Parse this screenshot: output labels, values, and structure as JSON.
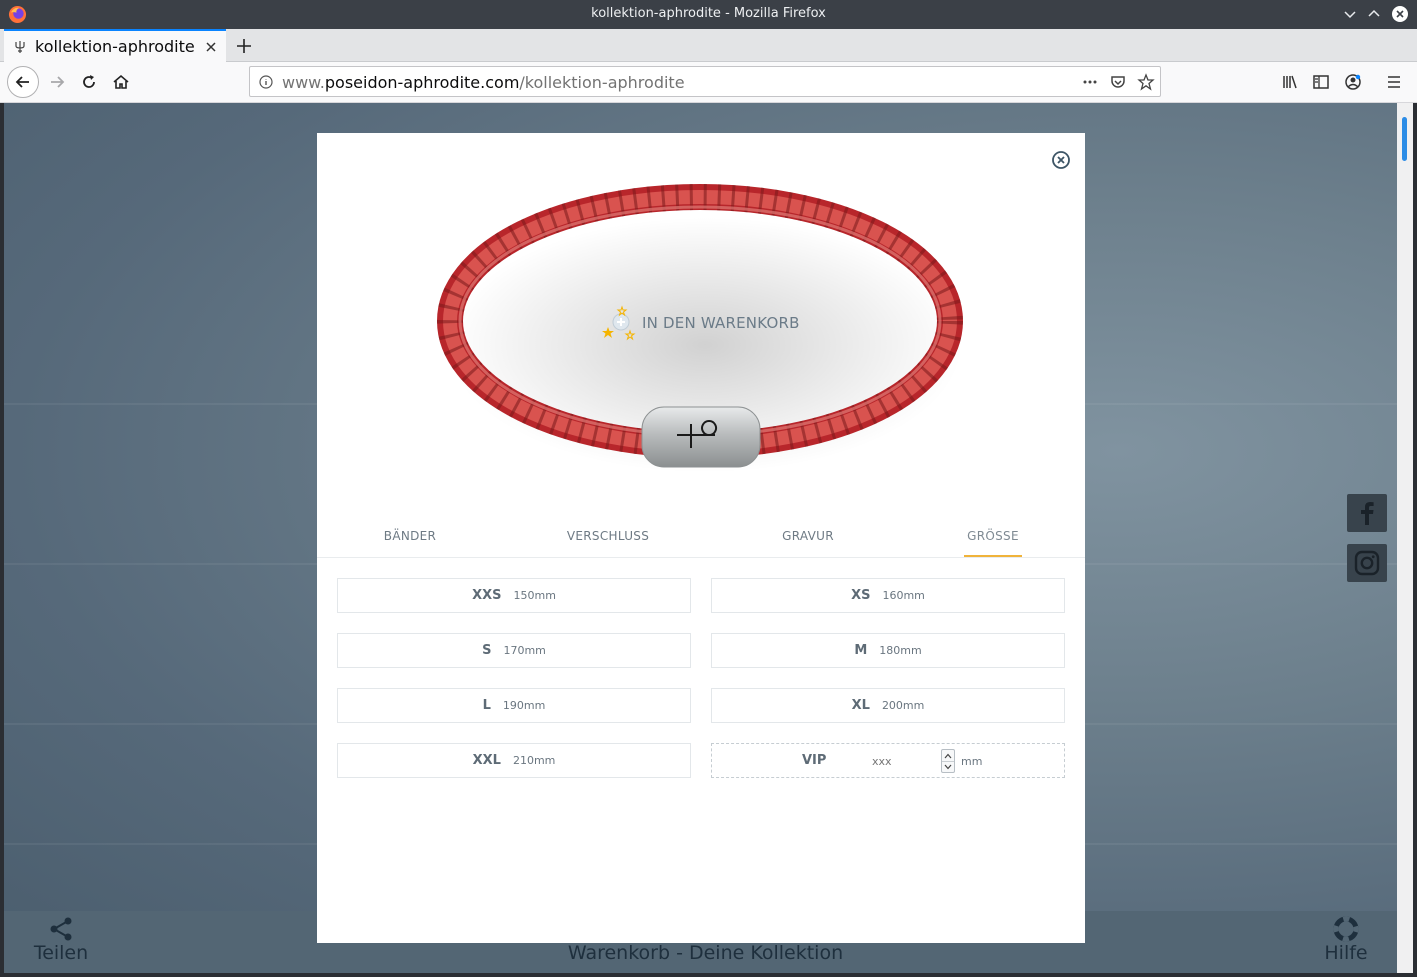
{
  "window": {
    "title": "kollektion-aphrodite - Mozilla Firefox"
  },
  "tab": {
    "label": "kollektion-aphrodite"
  },
  "urlbar": {
    "scheme_host_prefix": "www.",
    "domain": "poseidon-aphrodite.com",
    "path": "/kollektion-aphrodite"
  },
  "modal": {
    "cart_cta": "IN DEN WARENKORB",
    "tabs": [
      "BÄNDER",
      "VERSCHLUSS",
      "GRAVUR",
      "GRÖSSE"
    ],
    "active_tab": "GRÖSSE",
    "sizes": [
      {
        "label": "XXS",
        "length": "150mm"
      },
      {
        "label": "XS",
        "length": "160mm"
      },
      {
        "label": "S",
        "length": "170mm"
      },
      {
        "label": "M",
        "length": "180mm"
      },
      {
        "label": "L",
        "length": "190mm"
      },
      {
        "label": "XL",
        "length": "200mm"
      },
      {
        "label": "XXL",
        "length": "210mm"
      }
    ],
    "vip": {
      "label": "VIP",
      "placeholder": "xxx",
      "unit": "mm"
    }
  },
  "bottombar": {
    "share": "Teilen",
    "cart": "Warenkorb - Deine Kollektion",
    "help": "Hilfe"
  },
  "colors": {
    "accent": "#f0b33a",
    "bracelet": "#c9302c",
    "page_bg": "#5f7281",
    "bar_bg": "#536674"
  }
}
